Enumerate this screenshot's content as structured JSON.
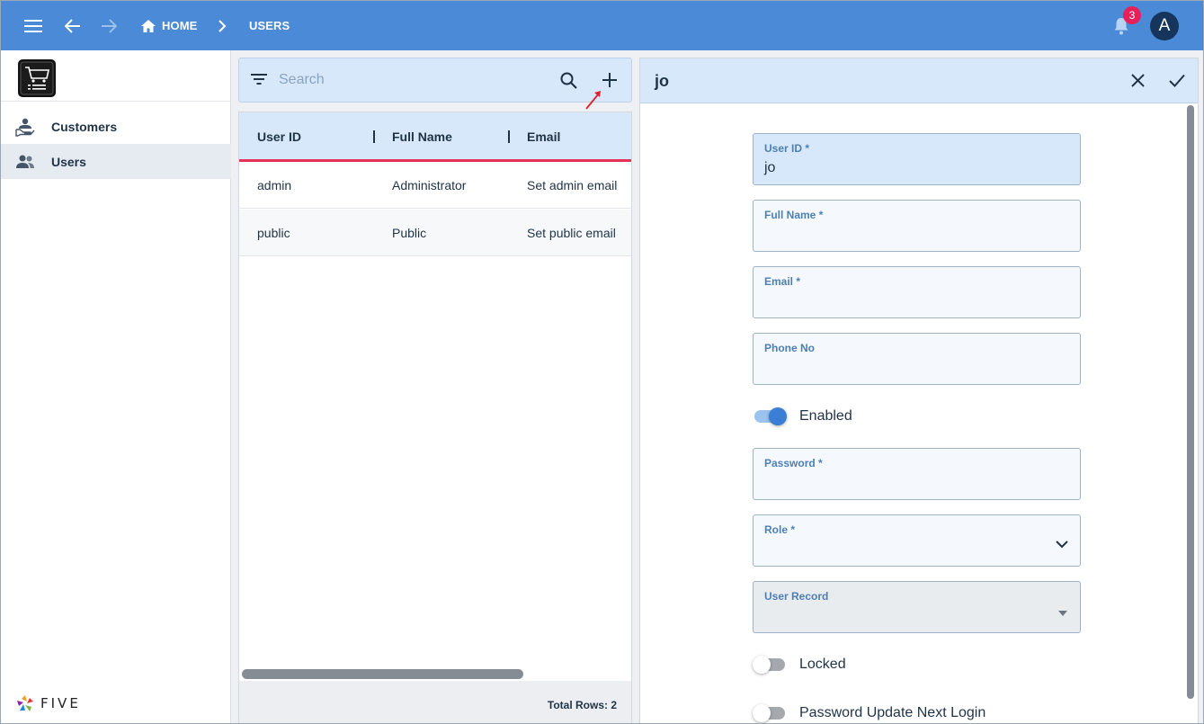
{
  "topbar": {
    "breadcrumb": [
      {
        "label": "HOME"
      },
      {
        "label": "USERS"
      }
    ],
    "notification_count": "3",
    "avatar_initial": "A"
  },
  "sidebar": {
    "items": [
      {
        "label": "Customers",
        "active": false
      },
      {
        "label": "Users",
        "active": true
      }
    ],
    "footer_logo": "FIVE"
  },
  "list": {
    "search_placeholder": "Search",
    "columns": [
      "User ID",
      "Full Name",
      "Email"
    ],
    "rows": [
      {
        "user_id": "admin",
        "full_name": "Administrator",
        "email": "Set admin email"
      },
      {
        "user_id": "public",
        "full_name": "Public",
        "email": "Set public email"
      }
    ],
    "total_rows": "Total Rows: 2"
  },
  "form": {
    "title": "jo",
    "fields": {
      "user_id": {
        "label": "User ID *",
        "value": "jo"
      },
      "full_name": {
        "label": "Full Name *",
        "value": ""
      },
      "email": {
        "label": "Email *",
        "value": ""
      },
      "phone": {
        "label": "Phone No",
        "value": ""
      },
      "password": {
        "label": "Password *",
        "value": ""
      },
      "role": {
        "label": "Role *",
        "value": ""
      },
      "user_record": {
        "label": "User Record",
        "value": ""
      }
    },
    "toggles": {
      "enabled": {
        "label": "Enabled",
        "on": true
      },
      "locked": {
        "label": "Locked",
        "on": false
      },
      "password_update": {
        "label": "Password Update Next Login",
        "on": false
      }
    }
  },
  "colors": {
    "topbar": "#4a8ad6",
    "accent_light": "#d6e8fa",
    "header_underline": "#e5325b",
    "badge": "#e8205a",
    "avatar": "#16355c",
    "toggle_on": "#3b7fd4"
  }
}
